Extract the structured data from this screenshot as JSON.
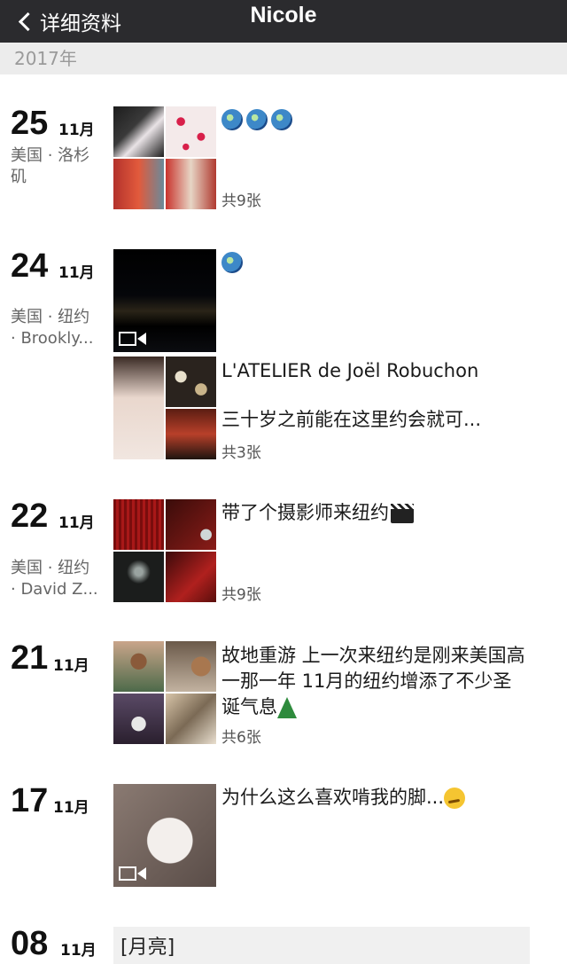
{
  "nav": {
    "back_label": "详细资料",
    "title": "Nicole"
  },
  "year": "2017年",
  "entries": [
    {
      "day": "25",
      "month": "11月",
      "loc1": "美国 · 洛杉",
      "loc2": "矶",
      "text": "",
      "emoji": "moon-emoji x3",
      "count": "共9张"
    },
    {
      "day": "24",
      "month": "11月",
      "loc1": "美国 · 纽约",
      "loc2": "· Brookly...",
      "text": "",
      "emoji": "moon-emoji"
    },
    {
      "text1": "L'ATELIER de Joël Robuchon",
      "text2": "三十岁之前能在这里约会就可...",
      "count": "共3张"
    },
    {
      "day": "22",
      "month": "11月",
      "loc1": "美国 · 纽约",
      "loc2": "· David Z...",
      "text": "带了个摄影师来纽约",
      "emoji": "clapper-emoji",
      "count": "共9张"
    },
    {
      "day": "21",
      "month": "11月",
      "text": "故地重游 上一次来纽约是刚来美国高一那一年 11月的纽约增添了不少圣诞气息",
      "emoji": "christmas-tree-emoji",
      "count": "共6张"
    },
    {
      "day": "17",
      "month": "11月",
      "text": "为什么这么喜欢啃我的脚...",
      "emoji": "smirk-emoji"
    },
    {
      "day": "08",
      "month": "11月",
      "text": "[月亮]"
    }
  ]
}
